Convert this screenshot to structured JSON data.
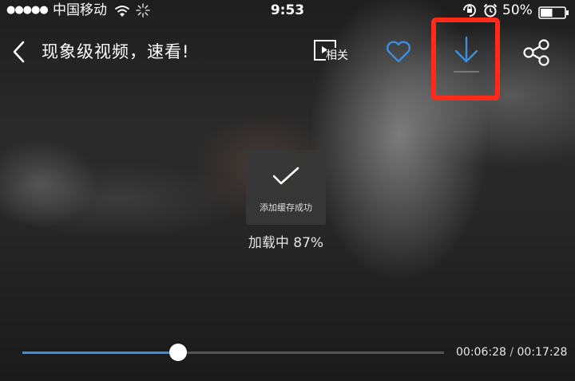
{
  "status_bar": {
    "signal": "●●●●●",
    "carrier": "中国移动",
    "time": "9:53",
    "battery_percent": "50%",
    "battery_level": 0.5
  },
  "top_bar": {
    "title": "现象级视频，速看!",
    "related_label": "相关",
    "accent_color": "#3a8fe0",
    "highlight_color": "#ff2a1a"
  },
  "toast": {
    "message": "添加缓存成功"
  },
  "loading": {
    "text": "加载中 87%"
  },
  "player": {
    "current_time": "00:06:28",
    "separator": "/",
    "total_time": "00:17:28",
    "progress_fraction": 0.37
  }
}
